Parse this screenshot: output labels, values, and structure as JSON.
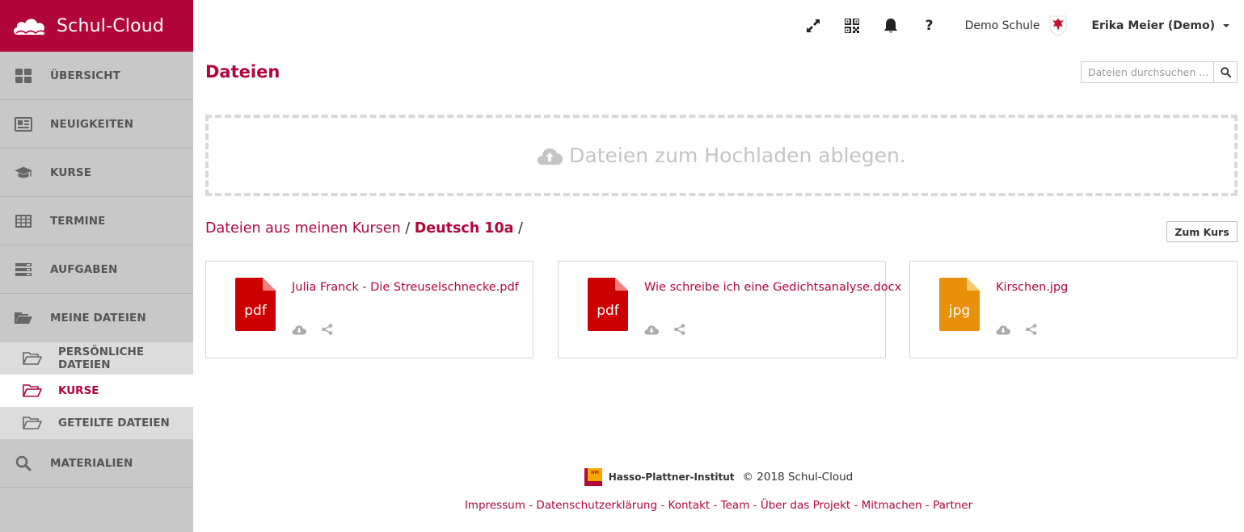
{
  "app": {
    "brand": "Schul-Cloud",
    "accent": "#b1063a"
  },
  "sidebar": {
    "items": [
      {
        "label": "Übersicht",
        "icon": "dashboard-icon"
      },
      {
        "label": "Neuigkeiten",
        "icon": "newspaper-icon"
      },
      {
        "label": "Kurse",
        "icon": "graduation-cap-icon"
      },
      {
        "label": "Termine",
        "icon": "calendar-table-icon"
      },
      {
        "label": "Aufgaben",
        "icon": "tasks-icon"
      },
      {
        "label": "Meine Dateien",
        "icon": "folder-open-icon"
      },
      {
        "label": "Materialien",
        "icon": "search-icon"
      }
    ],
    "sub_items": [
      {
        "label": "Persönliche Dateien",
        "icon": "folder-outline-icon"
      },
      {
        "label": "Kurse",
        "icon": "folder-outline-icon",
        "active": true
      },
      {
        "label": "geteilte Dateien",
        "icon": "folder-outline-icon"
      }
    ]
  },
  "topbar": {
    "icons": [
      "fullscreen-icon",
      "qr-code-icon",
      "bell-icon",
      "help-icon"
    ],
    "help": "?",
    "school": "Demo Schule",
    "user": "Erika Meier (Demo)"
  },
  "main": {
    "title": "Dateien",
    "search_placeholder": "Dateien durchsuchen ...",
    "dropzone": "Dateien zum Hochladen ablegen.",
    "breadcrumb": {
      "root": "Dateien aus meinen Kursen",
      "sep": "/",
      "current": "Deutsch 10a",
      "trail": "/"
    },
    "course_button": "Zum Kurs",
    "files": [
      {
        "name": "Julia Franck - Die Streuselschnecke.pdf",
        "type": "pdf",
        "color": "#cc0000"
      },
      {
        "name": "Wie schreibe ich eine Gedichtsanalyse.docx",
        "type": "pdf",
        "color": "#cc0000"
      },
      {
        "name": "Kirschen.jpg",
        "type": "jpg",
        "color": "#e8900a"
      }
    ]
  },
  "footer": {
    "hpi": "Hasso-Plattner-Institut",
    "copyright": "© 2018 Schul-Cloud",
    "links": [
      "Impressum",
      "Datenschutzerklärung",
      "Kontakt",
      "Team",
      "Über das Projekt",
      "Mitmachen",
      "Partner"
    ],
    "sep": "-"
  }
}
